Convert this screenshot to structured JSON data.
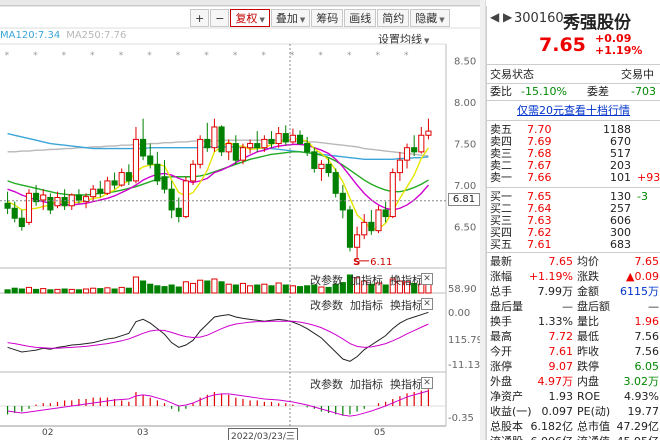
{
  "toolbar": {
    "items": [
      {
        "label": "+",
        "active": false,
        "dd": false
      },
      {
        "label": "−",
        "active": false,
        "dd": false
      },
      {
        "label": "复权",
        "active": true,
        "dd": true
      },
      {
        "label": "叠加",
        "active": false,
        "dd": true
      },
      {
        "label": "筹码",
        "active": false,
        "dd": false
      },
      {
        "label": "画线",
        "active": false,
        "dd": false
      },
      {
        "label": "简约",
        "active": false,
        "dd": false
      },
      {
        "label": "隐藏",
        "active": false,
        "dd": true
      }
    ]
  },
  "ma_legend": [
    {
      "text": "MA120:7.34",
      "color": "#3aa5d8"
    },
    {
      "text": "MA250:7.76",
      "color": "#b8b8b8"
    }
  ],
  "setting_label": "设置均线",
  "price_axis": [
    "8.50",
    "8.00",
    "7.50",
    "7.00",
    "6.50"
  ],
  "cursor_price": "6.81",
  "low_annotation": "6.11",
  "marker_glyph": "S",
  "panels": [
    {
      "param": "改参数",
      "indicator": "加指标",
      "switch": "换指标",
      "close": "✕",
      "scale_top": "58.90",
      "scale_bottom": "0.00"
    },
    {
      "param": "改参数",
      "indicator": "加指标",
      "switch": "换指标",
      "close": "✕",
      "scale_top": "115.79",
      "scale_bottom": "-11.13"
    },
    {
      "param": "改参数",
      "indicator": "加指标",
      "switch": "换指标",
      "close": "✕",
      "scale_top": "",
      "scale_bottom": "-0.35"
    }
  ],
  "xaxis": {
    "m1": "02",
    "m2": "03",
    "date": "2022/03/23/三",
    "m3": "05"
  },
  "stock": {
    "code": "300160",
    "name": "秀强股份",
    "price": "7.65",
    "change": "+0.09",
    "change_pct": "+1.19%",
    "nav": "◀ ▶"
  },
  "trade_status": {
    "label": "交易状态",
    "value": "交易中"
  },
  "ratio": {
    "wb_label": "委比",
    "wb_value": "-15.10%",
    "wc_label": "委差",
    "wc_value": "-703"
  },
  "promo": "仅需20元查看十档行情",
  "asks": [
    {
      "label": "卖五",
      "price": "7.70",
      "vol": "1188",
      "diff": ""
    },
    {
      "label": "卖四",
      "price": "7.69",
      "vol": "670",
      "diff": ""
    },
    {
      "label": "卖三",
      "price": "7.68",
      "vol": "517",
      "diff": ""
    },
    {
      "label": "卖二",
      "price": "7.67",
      "vol": "203",
      "diff": ""
    },
    {
      "label": "卖一",
      "price": "7.66",
      "vol": "101",
      "diff": "+93"
    }
  ],
  "bids": [
    {
      "label": "买一",
      "price": "7.65",
      "vol": "130",
      "diff": "-3"
    },
    {
      "label": "买二",
      "price": "7.64",
      "vol": "257",
      "diff": ""
    },
    {
      "label": "买三",
      "price": "7.63",
      "vol": "606",
      "diff": ""
    },
    {
      "label": "买四",
      "price": "7.62",
      "vol": "300",
      "diff": ""
    },
    {
      "label": "买五",
      "price": "7.61",
      "vol": "683",
      "diff": ""
    }
  ],
  "stats": [
    {
      "l1": "最新",
      "v1": "7.65",
      "c1": "red",
      "l2": "均价",
      "v2": "7.65",
      "c2": "red"
    },
    {
      "l1": "涨幅",
      "v1": "+1.19%",
      "c1": "red",
      "l2": "涨跌",
      "v2": "▲0.09",
      "c2": "red"
    },
    {
      "l1": "总手",
      "v1": "7.99万",
      "c1": "",
      "l2": "金额",
      "v2": "6115万",
      "c2": "blue"
    },
    {
      "l1": "盘后量",
      "v1": "—",
      "c1": "",
      "l2": "盘后额",
      "v2": "—",
      "c2": ""
    },
    {
      "l1": "换手",
      "v1": "1.33%",
      "c1": "",
      "l2": "量比",
      "v2": "1.96",
      "c2": "red"
    },
    {
      "l1": "最高",
      "v1": "7.72",
      "c1": "red",
      "l2": "最低",
      "v2": "7.56",
      "c2": ""
    },
    {
      "l1": "今开",
      "v1": "7.61",
      "c1": "red",
      "l2": "昨收",
      "v2": "7.56",
      "c2": ""
    },
    {
      "l1": "涨停",
      "v1": "9.07",
      "c1": "red",
      "l2": "跌停",
      "v2": "6.05",
      "c2": "green"
    },
    {
      "l1": "外盘",
      "v1": "4.97万",
      "c1": "red",
      "l2": "内盘",
      "v2": "3.02万",
      "c2": "green"
    },
    {
      "l1": "净资产",
      "v1": "1.93",
      "c1": "",
      "l2": "ROE",
      "v2": "4.93%",
      "c2": ""
    },
    {
      "l1": "收益(一)",
      "v1": "0.097",
      "c1": "",
      "l2": "PE(动)",
      "v2": "19.77",
      "c2": ""
    },
    {
      "l1": "总股本",
      "v1": "6.182亿",
      "c1": "",
      "l2": "总市值",
      "v2": "47.29亿",
      "c2": ""
    },
    {
      "l1": "流通股",
      "v1": "6.006亿",
      "c1": "",
      "l2": "流通值",
      "v2": "45.95亿",
      "c2": ""
    }
  ],
  "colors": {
    "up": "#e00000",
    "down": "#008000",
    "ma5": "#e6e600",
    "ma10": "#d000d0",
    "ma20": "#22aa22",
    "ma60": "#3aa5d8",
    "ma120": "#b8b8b8"
  },
  "chart_data": {
    "type": "candlestick",
    "y_range": [
      6.0,
      8.7
    ],
    "candles": [
      {
        "o": 6.78,
        "h": 6.92,
        "l": 6.65,
        "c": 6.72
      },
      {
        "o": 6.72,
        "h": 6.8,
        "l": 6.55,
        "c": 6.6
      },
      {
        "o": 6.6,
        "h": 6.7,
        "l": 6.45,
        "c": 6.5
      },
      {
        "o": 6.55,
        "h": 6.95,
        "l": 6.52,
        "c": 6.9
      },
      {
        "o": 6.9,
        "h": 7.0,
        "l": 6.75,
        "c": 6.8
      },
      {
        "o": 6.82,
        "h": 6.95,
        "l": 6.7,
        "c": 6.88
      },
      {
        "o": 6.85,
        "h": 6.9,
        "l": 6.65,
        "c": 6.7
      },
      {
        "o": 6.75,
        "h": 6.92,
        "l": 6.72,
        "c": 6.85
      },
      {
        "o": 6.85,
        "h": 6.95,
        "l": 6.7,
        "c": 6.75
      },
      {
        "o": 6.75,
        "h": 6.9,
        "l": 6.7,
        "c": 6.88
      },
      {
        "o": 6.88,
        "h": 6.95,
        "l": 6.78,
        "c": 6.82
      },
      {
        "o": 6.8,
        "h": 6.9,
        "l": 6.72,
        "c": 6.86
      },
      {
        "o": 6.86,
        "h": 7.0,
        "l": 6.8,
        "c": 6.95
      },
      {
        "o": 6.95,
        "h": 7.05,
        "l": 6.85,
        "c": 6.9
      },
      {
        "o": 6.9,
        "h": 7.1,
        "l": 6.88,
        "c": 7.05
      },
      {
        "o": 7.05,
        "h": 7.15,
        "l": 6.95,
        "c": 7.0
      },
      {
        "o": 7.0,
        "h": 7.2,
        "l": 6.98,
        "c": 7.15
      },
      {
        "o": 7.15,
        "h": 7.25,
        "l": 7.0,
        "c": 7.05
      },
      {
        "o": 7.05,
        "h": 7.7,
        "l": 7.02,
        "c": 7.55
      },
      {
        "o": 7.55,
        "h": 7.8,
        "l": 7.3,
        "c": 7.35
      },
      {
        "o": 7.35,
        "h": 7.5,
        "l": 7.2,
        "c": 7.25
      },
      {
        "o": 7.25,
        "h": 7.4,
        "l": 7.0,
        "c": 7.05
      },
      {
        "o": 7.1,
        "h": 7.3,
        "l": 6.9,
        "c": 6.95
      },
      {
        "o": 6.95,
        "h": 7.05,
        "l": 6.6,
        "c": 6.7
      },
      {
        "o": 6.72,
        "h": 6.85,
        "l": 6.55,
        "c": 6.62
      },
      {
        "o": 6.62,
        "h": 7.1,
        "l": 6.6,
        "c": 7.05
      },
      {
        "o": 7.05,
        "h": 7.3,
        "l": 7.0,
        "c": 7.25
      },
      {
        "o": 7.25,
        "h": 7.6,
        "l": 7.2,
        "c": 7.55
      },
      {
        "o": 7.55,
        "h": 7.75,
        "l": 7.4,
        "c": 7.45
      },
      {
        "o": 7.45,
        "h": 7.8,
        "l": 7.4,
        "c": 7.7
      },
      {
        "o": 7.7,
        "h": 7.72,
        "l": 7.35,
        "c": 7.4
      },
      {
        "o": 7.4,
        "h": 7.55,
        "l": 7.3,
        "c": 7.5
      },
      {
        "o": 7.5,
        "h": 7.6,
        "l": 7.25,
        "c": 7.3
      },
      {
        "o": 7.3,
        "h": 7.5,
        "l": 7.25,
        "c": 7.45
      },
      {
        "o": 7.45,
        "h": 7.55,
        "l": 7.38,
        "c": 7.5
      },
      {
        "o": 7.5,
        "h": 7.65,
        "l": 7.4,
        "c": 7.45
      },
      {
        "o": 7.45,
        "h": 7.6,
        "l": 7.4,
        "c": 7.55
      },
      {
        "o": 7.55,
        "h": 7.65,
        "l": 7.45,
        "c": 7.5
      },
      {
        "o": 7.5,
        "h": 7.7,
        "l": 7.45,
        "c": 7.62
      },
      {
        "o": 7.62,
        "h": 7.72,
        "l": 7.48,
        "c": 7.52
      },
      {
        "o": 7.52,
        "h": 7.68,
        "l": 7.5,
        "c": 7.6
      },
      {
        "o": 7.6,
        "h": 7.66,
        "l": 7.48,
        "c": 7.5
      },
      {
        "o": 7.5,
        "h": 7.58,
        "l": 7.35,
        "c": 7.4
      },
      {
        "o": 7.4,
        "h": 7.45,
        "l": 7.15,
        "c": 7.2
      },
      {
        "o": 7.2,
        "h": 7.3,
        "l": 7.05,
        "c": 7.25
      },
      {
        "o": 7.25,
        "h": 7.32,
        "l": 7.1,
        "c": 7.15
      },
      {
        "o": 7.15,
        "h": 7.2,
        "l": 6.85,
        "c": 6.9
      },
      {
        "o": 6.9,
        "h": 7.0,
        "l": 6.6,
        "c": 6.7
      },
      {
        "o": 6.7,
        "h": 6.75,
        "l": 6.2,
        "c": 6.25
      },
      {
        "o": 6.25,
        "h": 6.5,
        "l": 6.11,
        "c": 6.4
      },
      {
        "o": 6.4,
        "h": 6.65,
        "l": 6.35,
        "c": 6.55
      },
      {
        "o": 6.55,
        "h": 6.7,
        "l": 6.4,
        "c": 6.45
      },
      {
        "o": 6.45,
        "h": 6.75,
        "l": 6.42,
        "c": 6.7
      },
      {
        "o": 6.7,
        "h": 6.8,
        "l": 6.55,
        "c": 6.62
      },
      {
        "o": 6.62,
        "h": 7.2,
        "l": 6.6,
        "c": 7.15
      },
      {
        "o": 7.15,
        "h": 7.4,
        "l": 7.05,
        "c": 7.3
      },
      {
        "o": 7.3,
        "h": 7.5,
        "l": 7.2,
        "c": 7.45
      },
      {
        "o": 7.45,
        "h": 7.6,
        "l": 7.35,
        "c": 7.4
      },
      {
        "o": 7.4,
        "h": 7.7,
        "l": 7.38,
        "c": 7.6
      },
      {
        "o": 7.6,
        "h": 7.8,
        "l": 7.55,
        "c": 7.65
      }
    ],
    "ma5": [
      6.8,
      6.76,
      6.7,
      6.71,
      6.72,
      6.74,
      6.76,
      6.81,
      6.79,
      6.79,
      6.79,
      6.81,
      6.84,
      6.85,
      6.9,
      6.94,
      7.01,
      7.05,
      7.16,
      7.22,
      7.24,
      7.25,
      7.23,
      7.06,
      6.91,
      6.87,
      6.91,
      7.03,
      7.18,
      7.4,
      7.46,
      7.52,
      7.47,
      7.47,
      7.43,
      7.44,
      7.45,
      7.49,
      7.52,
      7.53,
      7.56,
      7.55,
      7.53,
      7.44,
      7.38,
      7.3,
      7.18,
      7.04,
      6.84,
      6.64,
      6.56,
      6.47,
      6.47,
      6.54,
      6.69,
      6.84,
      6.98,
      7.12,
      7.32,
      7.45
    ],
    "ma10": [
      6.95,
      6.92,
      6.88,
      6.85,
      6.82,
      6.8,
      6.78,
      6.77,
      6.76,
      6.76,
      6.77,
      6.78,
      6.8,
      6.82,
      6.84,
      6.87,
      6.91,
      6.95,
      7.0,
      7.06,
      7.1,
      7.13,
      7.14,
      7.12,
      7.08,
      7.05,
      7.03,
      7.05,
      7.08,
      7.15,
      7.18,
      7.22,
      7.27,
      7.32,
      7.36,
      7.4,
      7.42,
      7.45,
      7.47,
      7.48,
      7.49,
      7.49,
      7.48,
      7.45,
      7.42,
      7.38,
      7.31,
      7.22,
      7.11,
      7.0,
      6.9,
      6.82,
      6.76,
      6.72,
      6.7,
      6.72,
      6.76,
      6.82,
      6.9,
      7.0
    ],
    "ma20": [
      7.05,
      7.02,
      7.0,
      6.98,
      6.96,
      6.94,
      6.92,
      6.9,
      6.89,
      6.88,
      6.88,
      6.88,
      6.89,
      6.9,
      6.91,
      6.92,
      6.94,
      6.96,
      6.98,
      7.01,
      7.04,
      7.07,
      7.09,
      7.1,
      7.1,
      7.1,
      7.1,
      7.11,
      7.13,
      7.16,
      7.19,
      7.22,
      7.25,
      7.28,
      7.31,
      7.33,
      7.35,
      7.37,
      7.38,
      7.39,
      7.4,
      7.4,
      7.39,
      7.38,
      7.36,
      7.33,
      7.29,
      7.24,
      7.18,
      7.12,
      7.06,
      7.01,
      6.97,
      6.94,
      6.92,
      6.92,
      6.94,
      6.97,
      7.01,
      7.06
    ],
    "ma60": [
      7.62,
      7.6,
      7.58,
      7.56,
      7.54,
      7.52,
      7.5,
      7.49,
      7.48,
      7.47,
      7.46,
      7.45,
      7.44,
      7.44,
      7.44,
      7.44,
      7.44,
      7.44,
      7.44,
      7.44,
      7.45,
      7.45,
      7.45,
      7.45,
      7.45,
      7.45,
      7.45,
      7.45,
      7.46,
      7.46,
      7.46,
      7.46,
      7.46,
      7.46,
      7.45,
      7.45,
      7.44,
      7.44,
      7.43,
      7.42,
      7.41,
      7.4,
      7.39,
      7.38,
      7.37,
      7.36,
      7.35,
      7.34,
      7.33,
      7.32,
      7.31,
      7.31,
      7.31,
      7.31,
      7.31,
      7.32,
      7.32,
      7.33,
      7.33,
      7.34
    ],
    "ma120": [
      7.4,
      7.4,
      7.41,
      7.41,
      7.42,
      7.42,
      7.43,
      7.43,
      7.44,
      7.44,
      7.45,
      7.45,
      7.46,
      7.46,
      7.47,
      7.47,
      7.48,
      7.48,
      7.49,
      7.49,
      7.5,
      7.5,
      7.51,
      7.51,
      7.52,
      7.52,
      7.53,
      7.53,
      7.53,
      7.53,
      7.54,
      7.54,
      7.54,
      7.54,
      7.54,
      7.54,
      7.54,
      7.54,
      7.54,
      7.54,
      7.53,
      7.53,
      7.52,
      7.52,
      7.51,
      7.5,
      7.49,
      7.48,
      7.47,
      7.46,
      7.44,
      7.43,
      7.42,
      7.41,
      7.4,
      7.39,
      7.38,
      7.37,
      7.36,
      7.35
    ],
    "volume": [
      8,
      12,
      10,
      14,
      9,
      11,
      8,
      9,
      10,
      9,
      8,
      10,
      12,
      11,
      13,
      10,
      14,
      12,
      40,
      30,
      22,
      18,
      16,
      20,
      15,
      28,
      24,
      32,
      30,
      35,
      28,
      22,
      20,
      24,
      18,
      20,
      22,
      18,
      25,
      20,
      18,
      16,
      18,
      20,
      15,
      14,
      22,
      26,
      45,
      38,
      30,
      22,
      25,
      20,
      35,
      30,
      28,
      24,
      22,
      26
    ],
    "macd_dif": [
      20,
      15,
      10,
      12,
      14,
      18,
      16,
      20,
      22,
      25,
      26,
      28,
      30,
      34,
      38,
      40,
      45,
      50,
      75,
      80,
      72,
      60,
      48,
      30,
      20,
      25,
      35,
      55,
      70,
      85,
      88,
      90,
      85,
      82,
      80,
      78,
      76,
      78,
      80,
      78,
      74,
      68,
      60,
      50,
      40,
      25,
      10,
      -5,
      -10,
      0,
      15,
      25,
      35,
      45,
      60,
      72,
      80,
      85,
      90,
      95
    ],
    "macd_dea": [
      30,
      28,
      25,
      22,
      20,
      19,
      18,
      18,
      19,
      20,
      21,
      22,
      24,
      26,
      28,
      31,
      34,
      38,
      44,
      50,
      55,
      57,
      56,
      52,
      47,
      43,
      41,
      42,
      46,
      53,
      60,
      66,
      70,
      72,
      74,
      75,
      75,
      76,
      76,
      76,
      76,
      74,
      71,
      67,
      62,
      55,
      47,
      38,
      28,
      22,
      20,
      21,
      24,
      28,
      34,
      41,
      49,
      56,
      63,
      70
    ],
    "kdj_bars": [
      -0.3,
      -0.25,
      -0.2,
      -0.1,
      0.05,
      0.1,
      0.1,
      0.15,
      0.2,
      0.2,
      0.25,
      0.25,
      0.3,
      0.3,
      0.3,
      0.25,
      0.2,
      0.15,
      0.5,
      0.4,
      0.3,
      0.2,
      0.1,
      -0.1,
      -0.2,
      -0.1,
      0.1,
      0.3,
      0.4,
      0.5,
      0.45,
      0.4,
      0.3,
      0.25,
      0.2,
      0.2,
      0.15,
      0.15,
      0.1,
      0.1,
      0.05,
      0.0,
      -0.05,
      -0.1,
      -0.2,
      -0.25,
      -0.3,
      -0.35,
      -0.3,
      -0.2,
      -0.1,
      0.0,
      0.1,
      0.15,
      0.25,
      0.35,
      0.45,
      0.5,
      0.55,
      0.6
    ],
    "macd_line": [
      -0.1,
      -0.12,
      -0.14,
      -0.12,
      -0.1,
      -0.08,
      -0.06,
      -0.04,
      -0.02,
      0.0,
      0.02,
      0.04,
      0.06,
      0.08,
      0.1,
      0.12,
      0.13,
      0.14,
      0.2,
      0.22,
      0.2,
      0.16,
      0.12,
      0.06,
      0.0,
      0.02,
      0.06,
      0.12,
      0.18,
      0.22,
      0.24,
      0.24,
      0.22,
      0.2,
      0.18,
      0.16,
      0.14,
      0.13,
      0.12,
      0.1,
      0.08,
      0.05,
      0.02,
      -0.02,
      -0.06,
      -0.1,
      -0.14,
      -0.18,
      -0.2,
      -0.18,
      -0.14,
      -0.1,
      -0.05,
      0.0,
      0.06,
      0.12,
      0.18,
      0.22,
      0.26,
      0.3
    ]
  }
}
